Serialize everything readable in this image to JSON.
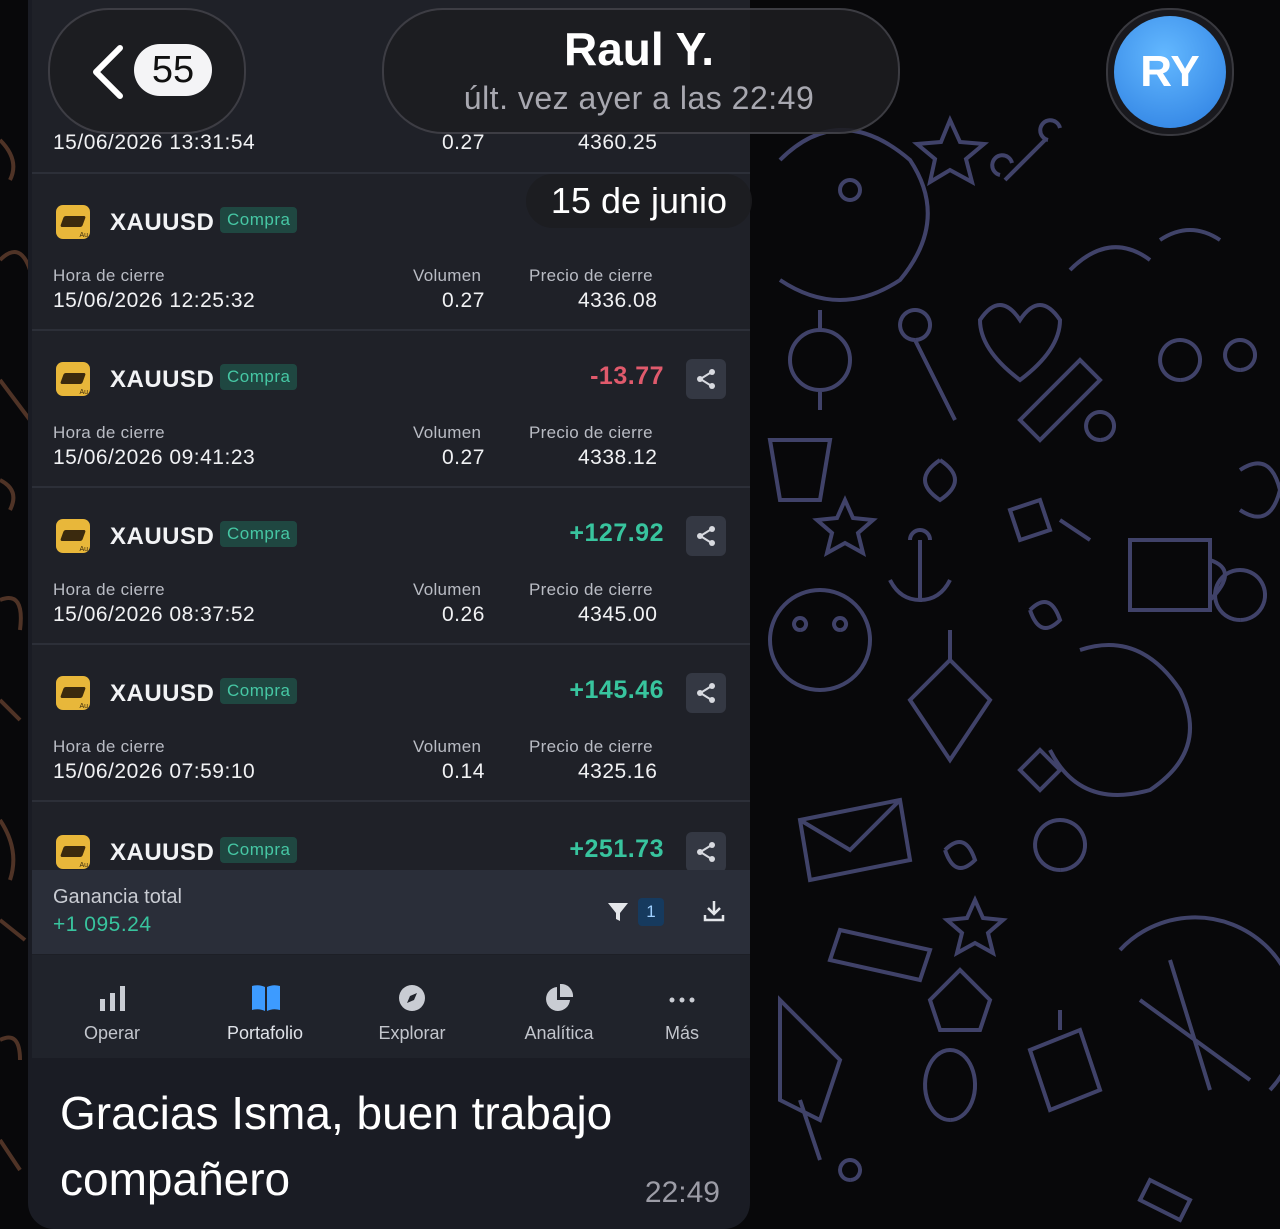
{
  "header": {
    "unread_count": "55",
    "chat_name": "Raul Y.",
    "status": "últ. vez ayer a las 22:49",
    "avatar_initials": "RY",
    "date_separator": "15 de junio"
  },
  "columns": {
    "close_time": "Hora de cierre",
    "volume": "Volumen",
    "close_price": "Precio de cierre"
  },
  "partial_top_trade": {
    "close_time": "15/06/2026 13:31:54",
    "volume": "0.27",
    "close_price": "4360.25"
  },
  "trades": [
    {
      "symbol": "XAUUSD",
      "side": "Compra",
      "profit": "",
      "close_time": "15/06/2026 12:25:32",
      "volume": "0.27",
      "close_price": "4336.08"
    },
    {
      "symbol": "XAUUSD",
      "side": "Compra",
      "profit": "-13.77",
      "close_time": "15/06/2026 09:41:23",
      "volume": "0.27",
      "close_price": "4338.12"
    },
    {
      "symbol": "XAUUSD",
      "side": "Compra",
      "profit": "+127.92",
      "close_time": "15/06/2026 08:37:52",
      "volume": "0.26",
      "close_price": "4345.00"
    },
    {
      "symbol": "XAUUSD",
      "side": "Compra",
      "profit": "+145.46",
      "close_time": "15/06/2026 07:59:10",
      "volume": "0.14",
      "close_price": "4325.16"
    },
    {
      "symbol": "XAUUSD",
      "side": "Compra",
      "profit": "+251.73",
      "close_time": "",
      "volume": "",
      "close_price": ""
    }
  ],
  "total": {
    "label": "Ganancia total",
    "value": "+1 095.24",
    "filter_count": "1"
  },
  "nav": [
    {
      "label": "Operar",
      "icon": "bar-chart-icon"
    },
    {
      "label": "Portafolio",
      "icon": "book-icon"
    },
    {
      "label": "Explorar",
      "icon": "compass-icon"
    },
    {
      "label": "Analítica",
      "icon": "pie-chart-icon"
    },
    {
      "label": "Más",
      "icon": "more-dots-icon"
    }
  ],
  "message": {
    "text": "Gracias Isma, buen trabajo compañero",
    "time": "22:49"
  },
  "colors": {
    "profit_positive": "#38c49e",
    "profit_negative": "#e05a6c",
    "badge_text": "#46c7a4",
    "avatar": "#2b7de0"
  }
}
